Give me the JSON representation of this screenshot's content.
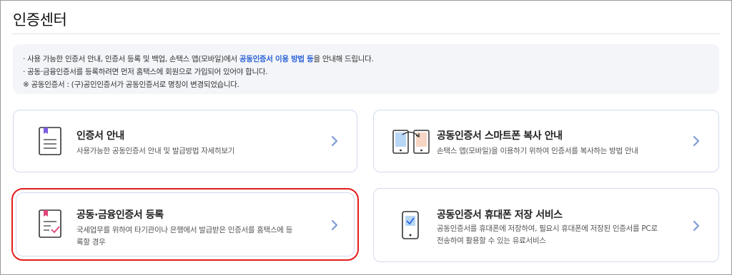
{
  "page": {
    "title": "인증센터"
  },
  "notice": {
    "line1_pre": "· 사용 가능한 인증서 안내, 인증서 등록 및 백업, 손택스 앱(모바일)에서 ",
    "line1_highlight": "공동인증서 이용 방법 등",
    "line1_post": "을 안내해 드립니다.",
    "line2": "· 공동·금융인증서를 등록하려면 먼저 홈택스에 회원으로 가입되어 있어야 합니다.",
    "line3": "※ 공동인증서 : (구)공인인증서가 공동인증서로 명칭이 변경되었습니다."
  },
  "cards": [
    {
      "title": "인증서 안내",
      "desc": "사용가능한 공동인증서 안내 및 발급방법 자세히보기",
      "icon": "certificate-document-icon"
    },
    {
      "title": "공동인증서 스마트폰 복사 안내",
      "desc": "손택스 앱(모바일)을 이용하기 위하여 인증서를 복사하는 방법 안내",
      "icon": "phone-copy-icon"
    },
    {
      "title": "공동·금융인증서 등록",
      "desc": "국세업무를 위하여 타기관이나 은행에서 발급받은 인증서를 홈택스에 등록할 경우",
      "icon": "certificate-register-icon",
      "selected": true
    },
    {
      "title": "공동인증서 휴대폰 저장 서비스",
      "desc": "공동인증서를 휴대폰에 저장하여, 필요시 휴대폰에 저장된 인증서를 PC로 전송하여 활용할 수 있는 유료서비스",
      "icon": "phone-storage-icon"
    }
  ],
  "colors": {
    "accent": "#2a62d6",
    "icon_pink": "#e0457b",
    "chevron": "#7f9bd6",
    "selection": "#e41c1c"
  }
}
